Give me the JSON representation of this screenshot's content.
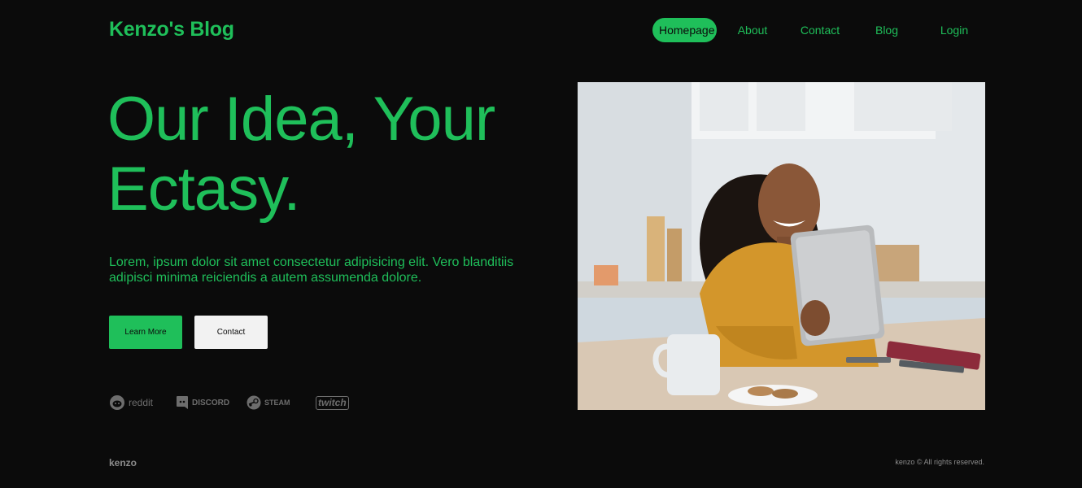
{
  "header": {
    "brand": "Kenzo's Blog",
    "nav": [
      {
        "label": "Homepage",
        "active": true
      },
      {
        "label": "About",
        "active": false
      },
      {
        "label": "Contact",
        "active": false
      },
      {
        "label": "Blog",
        "active": false
      },
      {
        "label": "Login",
        "active": false
      }
    ]
  },
  "hero": {
    "title_line1": "Our Idea, Your",
    "title_line2": "Ectasy.",
    "text": "Lorem, ipsum dolor sit amet consectetur adipisicing elit. Vero blanditiis adipisci minima reiciendis a autem assumenda dolore.",
    "primary_button": "Learn More",
    "secondary_button": "Contact",
    "image_icon": "woman-with-tablet-photo"
  },
  "partners": [
    {
      "name": "reddit",
      "icon": "reddit-icon"
    },
    {
      "name": "DISCORD",
      "icon": "discord-icon"
    },
    {
      "name": "STEAM",
      "icon": "steam-icon"
    },
    {
      "name": "twitch",
      "icon": "twitch-icon"
    }
  ],
  "footer": {
    "brand": "kenzo",
    "copyright": "kenzo © All rights reserved."
  },
  "colors": {
    "accent": "#1fbf5a",
    "background": "#0b0b0b",
    "muted": "#8c8c8c"
  }
}
